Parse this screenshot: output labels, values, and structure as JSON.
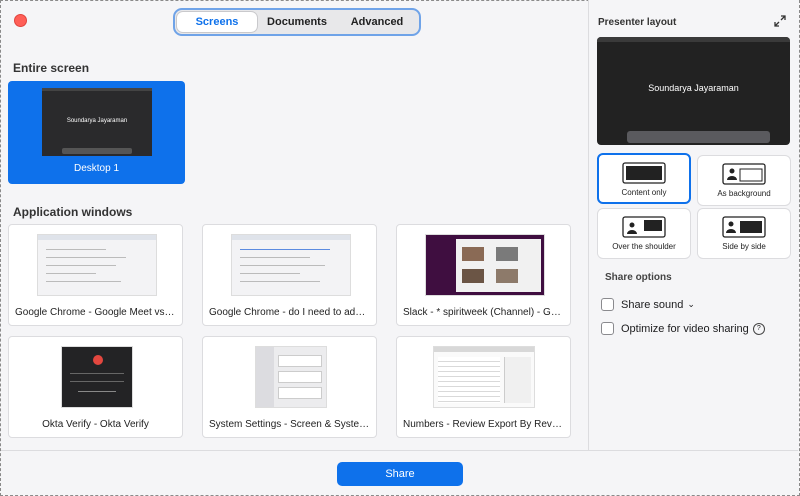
{
  "tabs": [
    {
      "label": "Screens",
      "active": true
    },
    {
      "label": "Documents",
      "active": false
    },
    {
      "label": "Advanced",
      "active": false
    }
  ],
  "entire_screen": {
    "title": "Entire screen",
    "desktop": {
      "label": "Desktop 1",
      "thumb_name": "Soundarya Jayaraman"
    }
  },
  "application_windows": {
    "title": "Application windows",
    "items": [
      {
        "label": "Google Chrome - Google Meet vs Z..."
      },
      {
        "label": "Google Chrome - do I need to add al..."
      },
      {
        "label": "Slack - * spiritweek (Channel) - G2 -..."
      },
      {
        "label": "Okta Verify - Okta Verify"
      },
      {
        "label": "System Settings - Screen & System..."
      },
      {
        "label": "Numbers - Review Export By Review..."
      }
    ]
  },
  "presenter": {
    "title": "Presenter layout",
    "preview_name": "Soundarya Jayaraman",
    "layouts": [
      {
        "label": "Content only",
        "selected": true
      },
      {
        "label": "As background",
        "selected": false
      },
      {
        "label": "Over the shoulder",
        "selected": false
      },
      {
        "label": "Side by side",
        "selected": false
      }
    ]
  },
  "share_options": {
    "title": "Share options",
    "share_sound": "Share sound",
    "optimize_video": "Optimize for video sharing"
  },
  "footer": {
    "share_label": "Share"
  },
  "colors": {
    "accent": "#0e71eb",
    "close": "#ff5f57"
  }
}
